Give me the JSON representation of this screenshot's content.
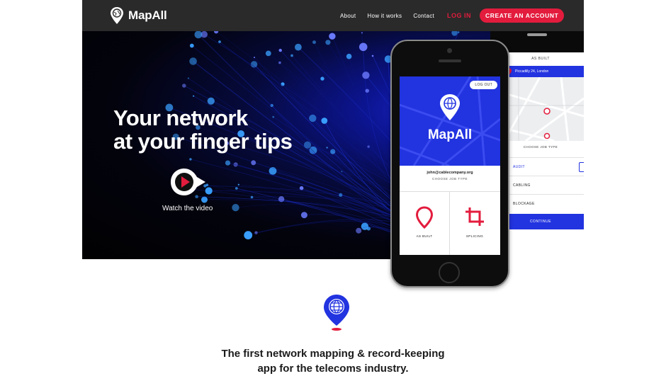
{
  "nav": {
    "brand": "MapAll",
    "links": [
      "About",
      "How it works",
      "Contact"
    ],
    "login": "LOG IN",
    "cta": "CREATE AN ACCOUNT"
  },
  "hero": {
    "title_line1": "Your network",
    "title_line2": "at your finger tips",
    "watch_label": "Watch the video"
  },
  "phone": {
    "logout": "LOG OUT",
    "brand": "MapAll",
    "email": "john@cablecompany.org",
    "choose": "CHOOSE JOB TYPE",
    "options": [
      "AS BUILT",
      "SPLICING"
    ]
  },
  "tablet": {
    "header": "AS BUILT",
    "location": "Piccadilly 24, London",
    "choose": "CHOOSE JOB TYPE",
    "jobs": [
      "AUDIT",
      "CABLING",
      "BLOCKAGE"
    ],
    "continue": "CONTINUE"
  },
  "tagline": {
    "line1": "The first network mapping & record-keeping",
    "line2": "app for the telecoms industry."
  },
  "colors": {
    "accent_red": "#e31c3d",
    "brand_blue": "#2233e0",
    "nav_bg": "#2a2a2a"
  }
}
